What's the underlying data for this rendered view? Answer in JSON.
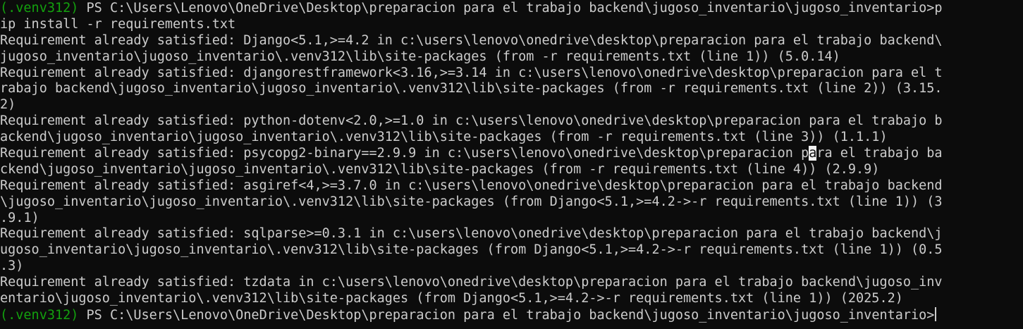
{
  "terminal": {
    "prompt1": {
      "venv": "(.venv312)",
      "text": " PS C:\\Users\\Lenovo\\OneDrive\\Desktop\\preparacion para el trabajo backend\\jugoso_inventario\\jugoso_inventario>p",
      "cont": "ip install -r requirements.txt"
    },
    "lines": [
      "Requirement already satisfied: Django<5.1,>=4.2 in c:\\users\\lenovo\\onedrive\\desktop\\preparacion para el trabajo backend\\",
      "jugoso_inventario\\jugoso_inventario\\.venv312\\lib\\site-packages (from -r requirements.txt (line 1)) (5.0.14)",
      "Requirement already satisfied: djangorestframework<3.16,>=3.14 in c:\\users\\lenovo\\onedrive\\desktop\\preparacion para el t",
      "rabajo backend\\jugoso_inventario\\jugoso_inventario\\.venv312\\lib\\site-packages (from -r requirements.txt (line 2)) (3.15.",
      "2)",
      "Requirement already satisfied: python-dotenv<2.0,>=1.0 in c:\\users\\lenovo\\onedrive\\desktop\\preparacion para el trabajo b",
      "ackend\\jugoso_inventario\\jugoso_inventario\\.venv312\\lib\\site-packages (from -r requirements.txt (line 3)) (1.1.1)"
    ],
    "psycopg_line": {
      "before": "Requirement already satisfied: psycopg2-binary==2.9.9 in c:\\users\\lenovo\\onedrive\\desktop\\preparacion p",
      "highlight": "a",
      "after": "ra el trabajo ba"
    },
    "lines2": [
      "ckend\\jugoso_inventario\\jugoso_inventario\\.venv312\\lib\\site-packages (from -r requirements.txt (line 4)) (2.9.9)",
      "Requirement already satisfied: asgiref<4,>=3.7.0 in c:\\users\\lenovo\\onedrive\\desktop\\preparacion para el trabajo backend",
      "\\jugoso_inventario\\jugoso_inventario\\.venv312\\lib\\site-packages (from Django<5.1,>=4.2->-r requirements.txt (line 1)) (3",
      ".9.1)",
      "Requirement already satisfied: sqlparse>=0.3.1 in c:\\users\\lenovo\\onedrive\\desktop\\preparacion para el trabajo backend\\j",
      "ugoso_inventario\\jugoso_inventario\\.venv312\\lib\\site-packages (from Django<5.1,>=4.2->-r requirements.txt (line 1)) (0.5",
      ".3)",
      "Requirement already satisfied: tzdata in c:\\users\\lenovo\\onedrive\\desktop\\preparacion para el trabajo backend\\jugoso_inv",
      "entario\\jugoso_inventario\\.venv312\\lib\\site-packages (from Django<5.1,>=4.2->-r requirements.txt (line 1)) (2025.2)"
    ],
    "prompt2": {
      "venv": "(.venv312)",
      "text": " PS C:\\Users\\Lenovo\\OneDrive\\Desktop\\preparacion para el trabajo backend\\jugoso_inventario\\jugoso_inventario>"
    }
  }
}
